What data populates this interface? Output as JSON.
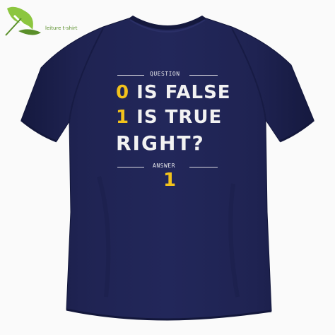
{
  "logo": {
    "text": "leiture t-shirt",
    "icon": "leaf-logo-icon",
    "color": "#5a8f2a"
  },
  "shirt": {
    "color": "#1d2150",
    "print": {
      "question_label": "QUESTION",
      "line1_digit": "0",
      "line1_text": " IS FALSE",
      "line2_digit": "1",
      "line2_text": " IS TRUE",
      "line3": "RIGHT?",
      "answer_label": "ANSWER",
      "answer_value": "1",
      "highlight_color": "#f2c21b",
      "text_color": "#f2f2f2"
    }
  }
}
